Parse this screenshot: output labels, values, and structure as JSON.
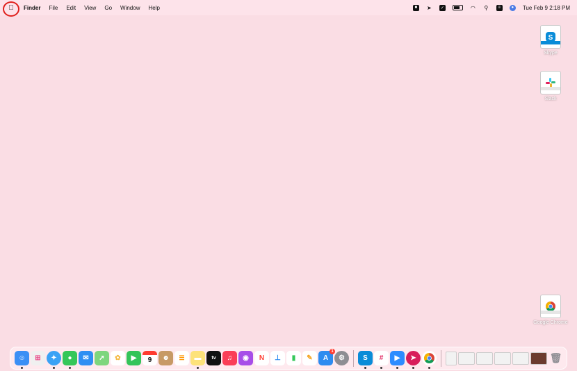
{
  "menubar": {
    "apple_icon": "",
    "items": [
      "Finder",
      "File",
      "Edit",
      "View",
      "Go",
      "Window",
      "Help"
    ],
    "clock": "Tue Feb 9  2:18 PM",
    "highlight_color": "#e0201c"
  },
  "desktop": {
    "icons": [
      {
        "label": "Skype",
        "accent": "#0a8cd8"
      },
      {
        "label": "Slack",
        "accent": "#e6e6e6"
      },
      {
        "label": "Google Chrome",
        "accent": "#e6e6e6"
      }
    ]
  },
  "dock": {
    "apps": [
      {
        "name": "Finder",
        "color": "#3b8ff5"
      },
      {
        "name": "Launchpad",
        "color": "#f0f0f0"
      },
      {
        "name": "Safari",
        "color": "#3aa2f5"
      },
      {
        "name": "Messages",
        "color": "#34c759"
      },
      {
        "name": "Mail",
        "color": "#2f8ff3"
      },
      {
        "name": "Maps",
        "color": "#7ed67e"
      },
      {
        "name": "Photos",
        "color": "#f4b942"
      },
      {
        "name": "FaceTime",
        "color": "#33c459"
      },
      {
        "name": "Calendar",
        "color": "#ffffff",
        "text": "9",
        "month": "FEB"
      },
      {
        "name": "Contacts",
        "color": "#c79a66"
      },
      {
        "name": "Reminders",
        "color": "#ffffff"
      },
      {
        "name": "Notes",
        "color": "#fde27a"
      },
      {
        "name": "Apple TV",
        "color": "#111111",
        "text": "tv"
      },
      {
        "name": "Music",
        "color": "#fa3e57"
      },
      {
        "name": "Podcasts",
        "color": "#a74ee8"
      },
      {
        "name": "News",
        "color": "#ffffff",
        "text": "N"
      },
      {
        "name": "Keynote",
        "color": "#ffffff"
      },
      {
        "name": "Numbers",
        "color": "#ffffff"
      },
      {
        "name": "Pages",
        "color": "#ffffff"
      },
      {
        "name": "App Store",
        "color": "#2d8cf0",
        "text": "A",
        "badge": "1"
      },
      {
        "name": "System Preferences",
        "color": "#8e8e93"
      },
      {
        "name": "Skype",
        "color": "#0a8cd8",
        "text": "S"
      },
      {
        "name": "Slack",
        "color": "#ffffff"
      },
      {
        "name": "Zoom",
        "color": "#2d8cff"
      },
      {
        "name": "Airmail",
        "color": "#d81e5b"
      },
      {
        "name": "Google Chrome",
        "color": "#ffffff"
      }
    ],
    "recent_items": [
      "Document",
      "Screenshot 1",
      "Screenshot 2",
      "Screenshot 3",
      "Screenshot 4",
      "Photo"
    ],
    "trash_label": "Trash"
  }
}
